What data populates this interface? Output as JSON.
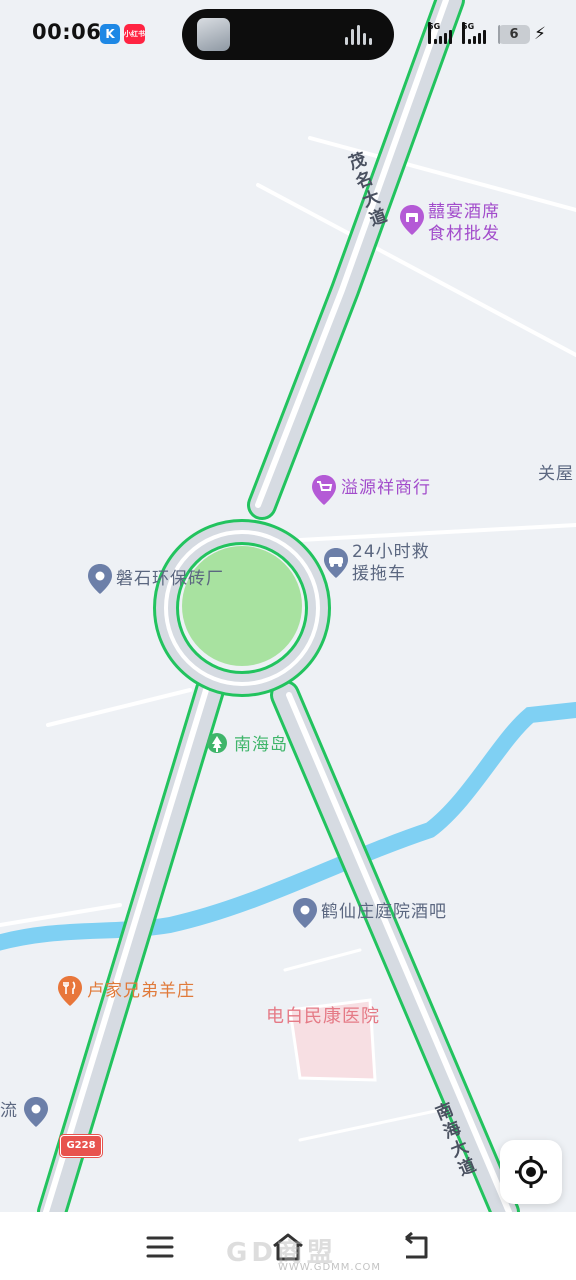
{
  "status_bar": {
    "time": "00:06",
    "app_icon_k": "K",
    "app_icon_red": "小红书",
    "signal_1": "5G",
    "signal_2": "5G",
    "battery_level": "6",
    "battery_fraction": 0.06
  },
  "map": {
    "pois": {
      "xiyan": [
        "囍宴酒席",
        "食材批发"
      ],
      "yiyuanxiang": "溢源祥商行",
      "guanwu": "关屋",
      "rescue": [
        "24小时救",
        "援拖车"
      ],
      "panshi": "磐石环保砖厂",
      "nanhaidao": "南海岛",
      "hexian": "鹤仙庄庭院酒吧",
      "lujia": "卢家兄弟羊庄",
      "hospital": "电白民康医院",
      "liu": "流"
    },
    "roads": {
      "maoming": [
        "茂",
        "名",
        "大",
        "道"
      ],
      "nanhai": [
        "南",
        "海",
        "大",
        "道"
      ]
    },
    "shield_label": "G228"
  },
  "icons": {
    "locate": "locate-icon",
    "menu": "menu-icon",
    "home": "home-icon",
    "back": "back-icon"
  },
  "watermark": {
    "main": "GD商盟",
    "url": "WWW.GDMM.COM"
  }
}
